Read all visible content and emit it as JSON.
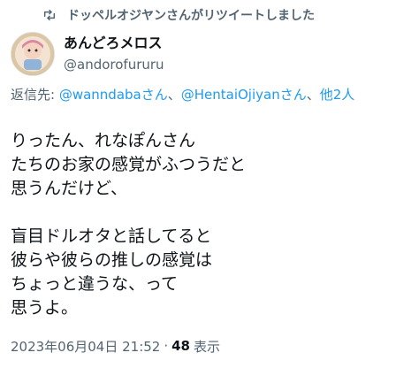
{
  "retweet": {
    "text": "ドッペルオジヤンさんがリツイートしました",
    "icon": "retweet-icon"
  },
  "author": {
    "display_name": "あんどろメロス",
    "handle": "@andorofururu"
  },
  "reply": {
    "prefix": "返信先: ",
    "mention1": "@wanndabaさん",
    "sep1": "、",
    "mention2": "@HentaiOjiyanさん",
    "sep2": "、",
    "mention3": "他2人"
  },
  "tweet": {
    "lines": [
      "りったん、れなぽんさん",
      "たちのお家の感覚がふつうだと",
      "思うんだけど、",
      "",
      "盲目ドルオタと話してると",
      "彼らや彼らの推しの感覚は",
      "ちょっと違うな、って",
      "思うよ。"
    ]
  },
  "meta": {
    "timestamp": "2023年06月04日 21:52",
    "separator": "·",
    "views_count": "48",
    "views_label": "表示"
  },
  "colors": {
    "text": "#0f1419",
    "secondary": "#536471",
    "link": "#1d9bf0"
  }
}
